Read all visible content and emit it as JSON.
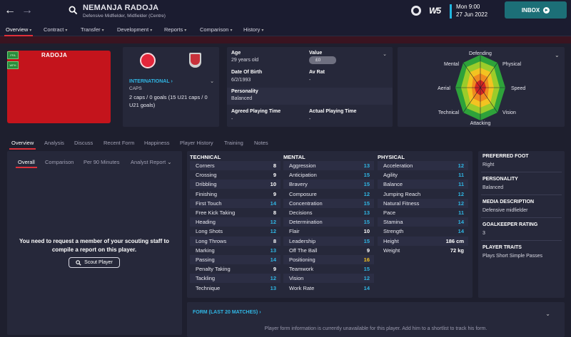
{
  "header": {
    "player_name": "NEMANJA RADOJA",
    "player_position": "Defensive Midfielder, Midfielder (Centre)",
    "logo_text": "W5",
    "date_line1": "Mon 9:00",
    "date_line2": "27 Jun 2022",
    "inbox_label": "INBOX"
  },
  "menu": [
    {
      "label": "Overview"
    },
    {
      "label": "Contract"
    },
    {
      "label": "Transfer"
    },
    {
      "label": "Development"
    },
    {
      "label": "Reports"
    },
    {
      "label": "Comparison"
    },
    {
      "label": "History"
    }
  ],
  "kit": {
    "name": "RADOJA",
    "tags": [
      "FFA",
      "WFH"
    ]
  },
  "international": {
    "title": "INTERNATIONAL",
    "caps_label": "CAPS",
    "caps_value": "2 caps / 0 goals (15 U21 caps / 0 U21 goals)"
  },
  "info": {
    "age_label": "Age",
    "age_value": "29 years old",
    "value_label": "Value",
    "value_value": "£0",
    "dob_label": "Date Of Birth",
    "dob_value": "6/2/1993",
    "avrat_label": "Av Rat",
    "avrat_value": "-",
    "personality_label": "Personality",
    "personality_value": "Balanced",
    "agreed_label": "Agreed Playing Time",
    "agreed_value": "-",
    "actual_label": "Actual Playing Time",
    "actual_value": "-"
  },
  "radar": {
    "labels": [
      "Defending",
      "Physical",
      "Speed",
      "Vision",
      "Attacking",
      "Technical",
      "Aerial",
      "Mental"
    ]
  },
  "subtabs": [
    "Overview",
    "Analysis",
    "Discuss",
    "Recent Form",
    "Happiness",
    "Player History",
    "Training",
    "Notes"
  ],
  "report": {
    "tabs": [
      "Overall",
      "Comparison",
      "Per 90 Minutes",
      "Analyst Report"
    ],
    "message": "You need to request a member of your scouting staff to compile a report on this player.",
    "button_label": "Scout Player"
  },
  "technical": {
    "title": "TECHNICAL",
    "rows": [
      {
        "name": "Corners",
        "value": "8"
      },
      {
        "name": "Crossing",
        "value": "9"
      },
      {
        "name": "Dribbling",
        "value": "10"
      },
      {
        "name": "Finishing",
        "value": "9"
      },
      {
        "name": "First Touch",
        "value": "14"
      },
      {
        "name": "Free Kick Taking",
        "value": "8"
      },
      {
        "name": "Heading",
        "value": "12"
      },
      {
        "name": "Long Shots",
        "value": "12"
      },
      {
        "name": "Long Throws",
        "value": "8"
      },
      {
        "name": "Marking",
        "value": "13"
      },
      {
        "name": "Passing",
        "value": "14"
      },
      {
        "name": "Penalty Taking",
        "value": "9"
      },
      {
        "name": "Tackling",
        "value": "12"
      },
      {
        "name": "Technique",
        "value": "13"
      }
    ]
  },
  "mental": {
    "title": "MENTAL",
    "rows": [
      {
        "name": "Aggression",
        "value": "13"
      },
      {
        "name": "Anticipation",
        "value": "15"
      },
      {
        "name": "Bravery",
        "value": "15"
      },
      {
        "name": "Composure",
        "value": "12"
      },
      {
        "name": "Concentration",
        "value": "15"
      },
      {
        "name": "Decisions",
        "value": "13"
      },
      {
        "name": "Determination",
        "value": "15"
      },
      {
        "name": "Flair",
        "value": "10"
      },
      {
        "name": "Leadership",
        "value": "15"
      },
      {
        "name": "Off The Ball",
        "value": "9"
      },
      {
        "name": "Positioning",
        "value": "16"
      },
      {
        "name": "Teamwork",
        "value": "15"
      },
      {
        "name": "Vision",
        "value": "12"
      },
      {
        "name": "Work Rate",
        "value": "14"
      }
    ]
  },
  "physical": {
    "title": "PHYSICAL",
    "rows": [
      {
        "name": "Acceleration",
        "value": "12"
      },
      {
        "name": "Agility",
        "value": "11"
      },
      {
        "name": "Balance",
        "value": "11"
      },
      {
        "name": "Jumping Reach",
        "value": "12"
      },
      {
        "name": "Natural Fitness",
        "value": "12"
      },
      {
        "name": "Pace",
        "value": "11"
      },
      {
        "name": "Stamina",
        "value": "14"
      },
      {
        "name": "Strength",
        "value": "14"
      }
    ],
    "height_label": "Height",
    "height_value": "186 cm",
    "weight_label": "Weight",
    "weight_value": "72 kg"
  },
  "side": {
    "foot_label": "PREFERRED FOOT",
    "foot_value": "Right",
    "personality_label": "PERSONALITY",
    "personality_value": "Balanced",
    "media_label": "MEDIA DESCRIPTION",
    "media_value": "Defensive midfielder",
    "gk_label": "GOALKEEPER RATING",
    "gk_value": "3",
    "traits_label": "PLAYER TRAITS",
    "traits_value": "Plays Short Simple Passes"
  },
  "form": {
    "title": "FORM (LAST 20 MATCHES)",
    "message": "Player form information is currently unavailable for this player. Add him to a shortlist to track his form."
  },
  "colors": {
    "accent_red": "#e0303a",
    "link_blue": "#30b6e4",
    "high_value": "#2fb5e3",
    "top_value": "#f3c321",
    "inbox": "#1c6f77"
  }
}
